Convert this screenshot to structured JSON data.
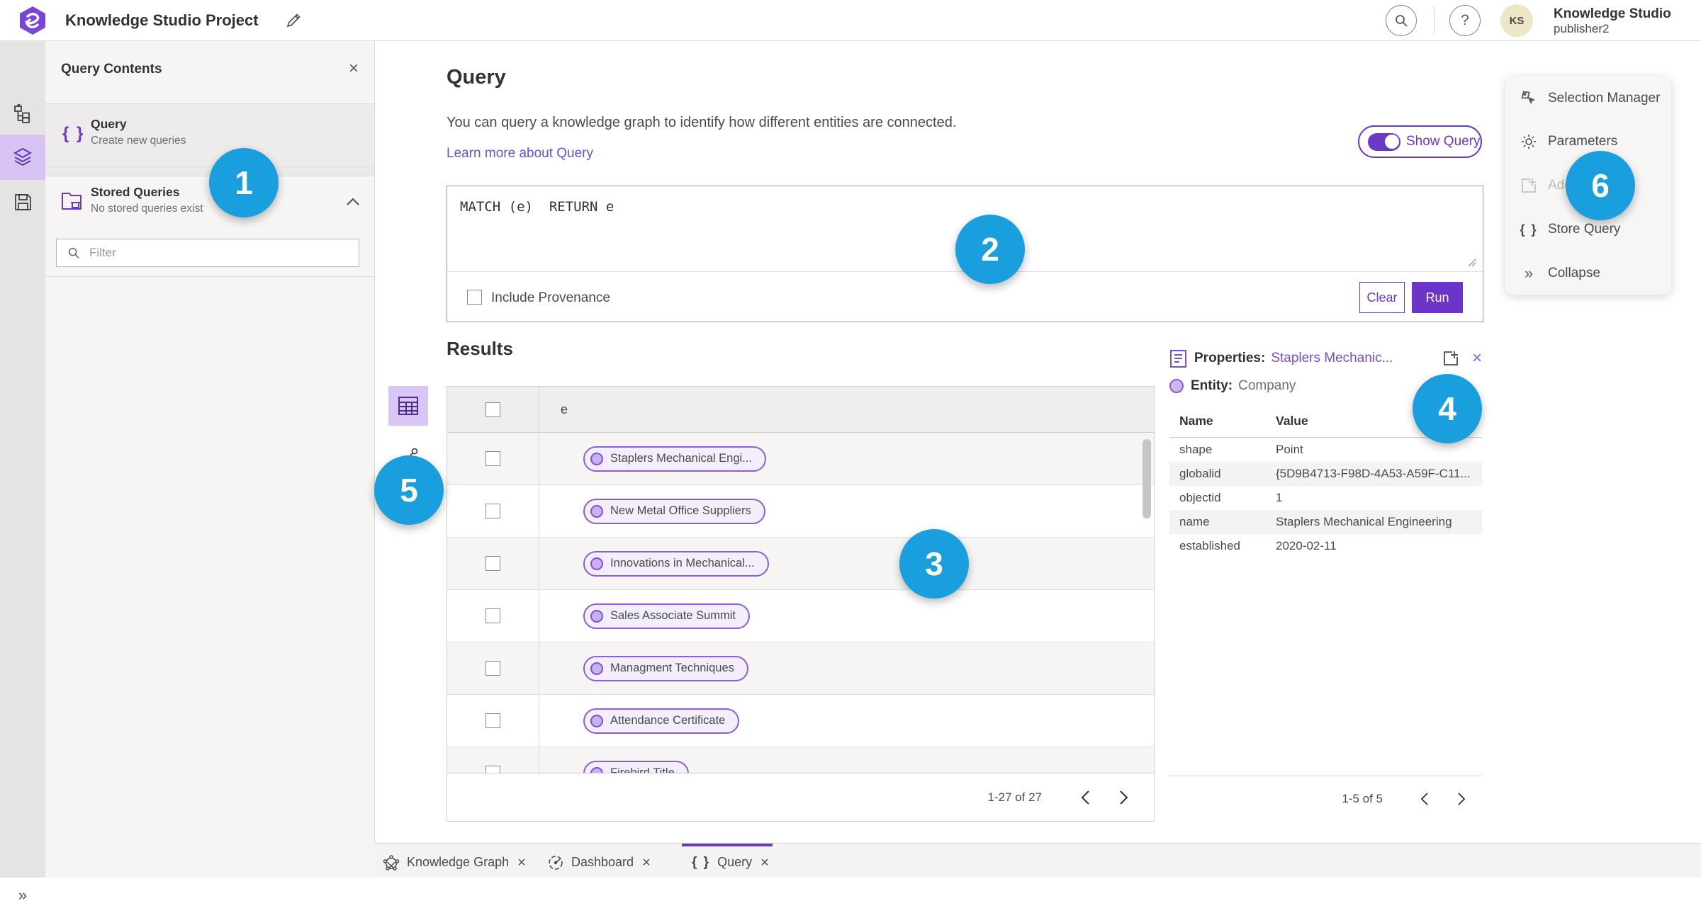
{
  "colors": {
    "accent_purple": "#6a3ac6",
    "run_button": "#6a35c8",
    "link_blue_purple": "#6253d8",
    "entity_purple_border": "#8a5ed8",
    "entity_purple_fill": "#f3edfc",
    "annotation_blue": "#199fdd",
    "rail_selected_bg": "#d8c4f4"
  },
  "header": {
    "title": "Knowledge Studio Project",
    "user_initials": "KS",
    "user_name": "Knowledge Studio",
    "user_role": "publisher2",
    "help_glyph": "?"
  },
  "panel": {
    "title": "Query Contents",
    "items": [
      {
        "title": "Query",
        "subtitle": "Create new queries"
      },
      {
        "title": "Stored Queries",
        "subtitle": "No stored queries exist"
      }
    ],
    "filter_placeholder": "Filter"
  },
  "query_section": {
    "title": "Query",
    "description": "You can query a knowledge graph to identify how different entities are connected.",
    "learn_more": "Learn more about Query",
    "show_query_label": "Show Query",
    "query_text": "MATCH (e)  RETURN e",
    "include_provenance_label": "Include Provenance",
    "clear_label": "Clear",
    "run_label": "Run"
  },
  "results": {
    "title": "Results",
    "column_header": "e",
    "rows": [
      {
        "label": "Staplers Mechanical Engi..."
      },
      {
        "label": "New Metal Office Suppliers"
      },
      {
        "label": "Innovations in Mechanical..."
      },
      {
        "label": "Sales Associate Summit"
      },
      {
        "label": "Managment Techniques"
      },
      {
        "label": "Attendance Certificate"
      },
      {
        "label": "Firebird Title"
      }
    ],
    "pagination": "1-27 of 27"
  },
  "properties": {
    "title": "Properties:",
    "entity_link": "Staplers Mechanic...",
    "entity_label": "Entity:",
    "entity_type": "Company",
    "columns": {
      "name": "Name",
      "value": "Value"
    },
    "rows": [
      {
        "name": "shape",
        "value": "Point"
      },
      {
        "name": "globalid",
        "value": "{5D9B4713-F98D-4A53-A59F-C11..."
      },
      {
        "name": "objectid",
        "value": "1"
      },
      {
        "name": "name",
        "value": "Staplers Mechanical Engineering"
      },
      {
        "name": "established",
        "value": "2020-02-11"
      }
    ],
    "pagination": "1-5 of 5"
  },
  "side_menu": {
    "items": [
      {
        "label": "Selection Manager"
      },
      {
        "label": "Parameters"
      },
      {
        "label": "Add To Map",
        "disabled": true
      },
      {
        "label": "Store Query"
      },
      {
        "label": "Collapse"
      }
    ]
  },
  "tabs": [
    {
      "label": "Knowledge Graph"
    },
    {
      "label": "Dashboard"
    },
    {
      "label": "Query",
      "active": true
    }
  ],
  "annotations": {
    "circles": [
      {
        "n": "1"
      },
      {
        "n": "2"
      },
      {
        "n": "3"
      },
      {
        "n": "4"
      },
      {
        "n": "5"
      },
      {
        "n": "6"
      }
    ]
  },
  "glyphs": {
    "braces": "{ }",
    "close": "×",
    "collapse": "»",
    "expand": "»"
  }
}
